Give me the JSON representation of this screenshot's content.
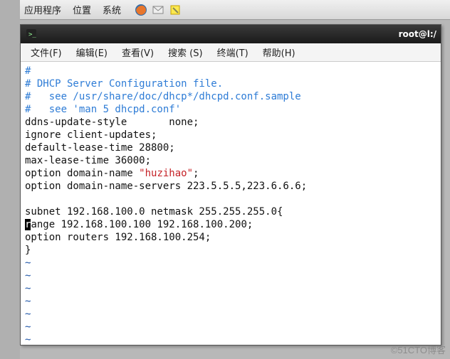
{
  "panel": {
    "apps": "应用程序",
    "places": "位置",
    "system": "系统"
  },
  "window": {
    "title": "root@l:/"
  },
  "menu": {
    "file": "文件(F)",
    "edit": "编辑(E)",
    "view": "查看(V)",
    "search": "搜索 (S)",
    "terminal": "终端(T)",
    "help": "帮助(H)"
  },
  "editor": {
    "lines": [
      {
        "cls": "c-comment",
        "text": "#"
      },
      {
        "cls": "c-comment",
        "text": "# DHCP Server Configuration file."
      },
      {
        "cls": "c-comment",
        "text": "#   see /usr/share/doc/dhcp*/dhcpd.conf.sample"
      },
      {
        "cls": "c-comment",
        "text": "#   see 'man 5 dhcpd.conf'"
      },
      {
        "cls": "c-text",
        "text": "ddns-update-style       none;"
      },
      {
        "cls": "c-text",
        "text": "ignore client-updates;"
      },
      {
        "cls": "c-text",
        "text": "default-lease-time 28800;"
      },
      {
        "cls": "c-text",
        "text": "max-lease-time 36000;"
      },
      {
        "cls": "mixed",
        "parts": [
          {
            "cls": "c-text",
            "text": "option domain-name "
          },
          {
            "cls": "c-str",
            "text": "\"huzihao\""
          },
          {
            "cls": "c-text",
            "text": ";"
          }
        ]
      },
      {
        "cls": "c-text",
        "text": "option domain-name-servers 223.5.5.5,223.6.6.6;"
      },
      {
        "cls": "c-text",
        "text": ""
      },
      {
        "cls": "c-text",
        "text": "subnet 192.168.100.0 netmask 255.255.255.0{"
      },
      {
        "cls": "mixed",
        "parts": [
          {
            "cls": "cursor",
            "text": "r"
          },
          {
            "cls": "c-text",
            "text": "ange 192.168.100.100 192.168.100.200;"
          }
        ]
      },
      {
        "cls": "c-text",
        "text": "option routers 192.168.100.254;"
      },
      {
        "cls": "c-text",
        "text": "}"
      },
      {
        "cls": "c-tilde",
        "text": "~"
      },
      {
        "cls": "c-tilde",
        "text": "~"
      },
      {
        "cls": "c-tilde",
        "text": "~"
      },
      {
        "cls": "c-tilde",
        "text": "~"
      },
      {
        "cls": "c-tilde",
        "text": "~"
      },
      {
        "cls": "c-tilde",
        "text": "~"
      },
      {
        "cls": "c-tilde",
        "text": "~"
      }
    ]
  },
  "watermark": "©51CTO博客"
}
